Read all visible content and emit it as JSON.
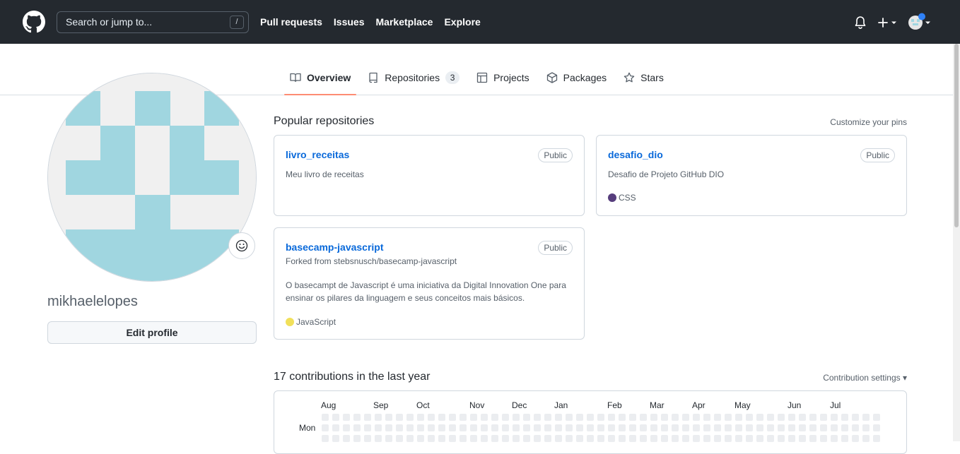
{
  "header": {
    "search_placeholder": "Search or jump to...",
    "search_shortcut": "/",
    "nav": [
      "Pull requests",
      "Issues",
      "Marketplace",
      "Explore"
    ]
  },
  "tabs": [
    {
      "label": "Overview",
      "icon": "book-icon",
      "active": true
    },
    {
      "label": "Repositories",
      "icon": "repo-icon",
      "counter": "3"
    },
    {
      "label": "Projects",
      "icon": "project-icon"
    },
    {
      "label": "Packages",
      "icon": "package-icon"
    },
    {
      "label": "Stars",
      "icon": "star-icon"
    }
  ],
  "profile": {
    "username": "mikhaelelopes",
    "edit_label": "Edit profile",
    "identicon_color": "#a0d6e0"
  },
  "popular": {
    "title": "Popular repositories",
    "customize": "Customize your pins",
    "repos": [
      {
        "name": "livro_receitas",
        "badge": "Public",
        "description": "Meu livro de receitas"
      },
      {
        "name": "desafio_dio",
        "badge": "Public",
        "description": "Desafio de Projeto GitHub DIO",
        "language": "CSS",
        "language_color": "#563d7c"
      },
      {
        "name": "basecamp-javascript",
        "badge": "Public",
        "forked_from": "Forked from stebsnusch/basecamp-javascript",
        "description": "O basecampt de Javascript é uma iniciativa da Digital Innovation One para ensinar os pilares da linguagem e seus conceitos mais básicos.",
        "language": "JavaScript",
        "language_color": "#f1e05a"
      }
    ]
  },
  "contributions": {
    "title": "17 contributions in the last year",
    "settings": "Contribution settings",
    "months": [
      "Aug",
      "Sep",
      "Oct",
      "Nov",
      "Dec",
      "Jan",
      "Feb",
      "Mar",
      "Apr",
      "May",
      "Jun",
      "Jul"
    ],
    "day_label": "Mon"
  }
}
